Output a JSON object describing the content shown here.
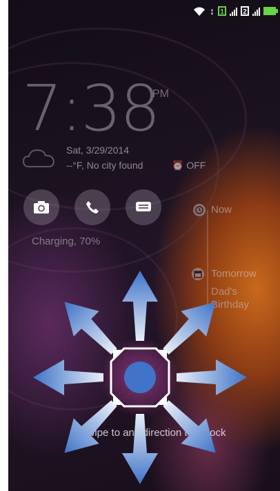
{
  "status_bar": {
    "wifi_icon": "wifi-icon",
    "sim1_label": "1",
    "sim2_label": "2",
    "battery_icon": "battery-charging-icon",
    "colors": {
      "sim1": "#6ad14a",
      "battery": "#6ad14a"
    }
  },
  "lockscreen": {
    "time": "7:38",
    "ampm": "PM",
    "date": "Sat, 3/29/2014",
    "weather": "--°F, No city found",
    "alarm": "OFF",
    "charging": "Charging, 70%",
    "quick_actions": [
      {
        "name": "camera",
        "icon": "camera-icon"
      },
      {
        "name": "phone",
        "icon": "phone-icon"
      },
      {
        "name": "messages",
        "icon": "message-icon"
      }
    ],
    "timeline": [
      {
        "label": "Now",
        "icon": "clock-icon"
      },
      {
        "label": "Tomorrow",
        "icon": "calendar-icon",
        "detail_line1": "Dad's",
        "detail_line2": "Birthday"
      }
    ],
    "unlock_hint": "Swipe to any direction to unlock",
    "arrow_color": "#3f74c8"
  }
}
